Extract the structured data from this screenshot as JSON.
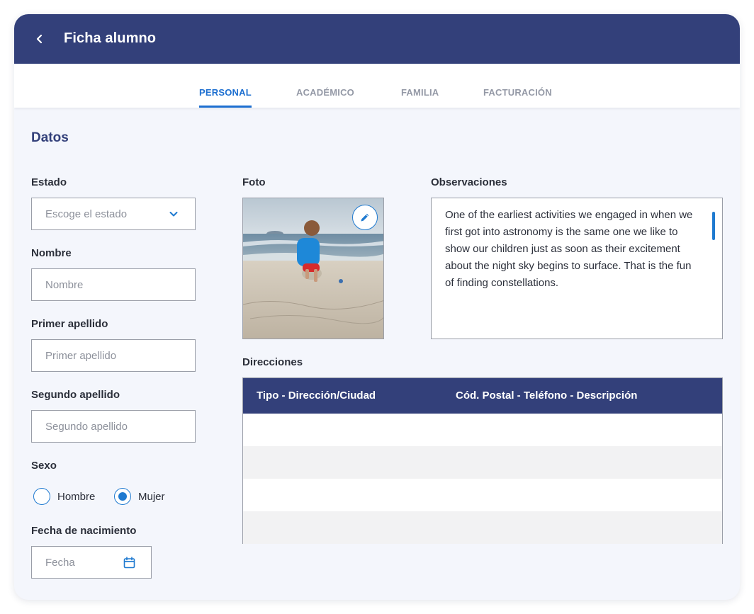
{
  "header": {
    "title": "Ficha alumno",
    "back_icon": "chevron-left-icon"
  },
  "tabs": [
    {
      "label": "PERSONAL",
      "active": true
    },
    {
      "label": "ACADÉMICO",
      "active": false
    },
    {
      "label": "FAMILIA",
      "active": false
    },
    {
      "label": "FACTURACIÓN",
      "active": false
    }
  ],
  "section": {
    "title": "Datos"
  },
  "form": {
    "estado": {
      "label": "Estado",
      "placeholder": "Escoge el estado",
      "icon": "chevron-down-icon"
    },
    "nombre": {
      "label": "Nombre",
      "placeholder": "Nombre"
    },
    "primer_apellido": {
      "label": "Primer apellido",
      "placeholder": "Primer apellido"
    },
    "segundo_apellido": {
      "label": "Segundo apellido",
      "placeholder": "Segundo apellido"
    },
    "sexo": {
      "label": "Sexo",
      "options": [
        {
          "label": "Hombre",
          "selected": false
        },
        {
          "label": "Mujer",
          "selected": true
        }
      ]
    },
    "fecha": {
      "label": "Fecha de nacimiento",
      "placeholder": "Fecha",
      "icon": "calendar-icon"
    }
  },
  "foto": {
    "label": "Foto",
    "edit_icon": "pencil-icon"
  },
  "observaciones": {
    "label": "Observaciones",
    "text": "One of the earliest activities we engaged in when we first got into astronomy is the same one we like to show our children just as soon as their excitement about the night sky begins to surface. That is the fun of finding constellations."
  },
  "direcciones": {
    "label": "Direcciones",
    "columns": [
      "Tipo - Dirección/Ciudad",
      "Cód. Postal - Teléfono - Descripción"
    ],
    "rows": [
      [],
      [],
      [],
      []
    ]
  },
  "colors": {
    "primary": "#33407a",
    "accent": "#1d6fd0",
    "background": "#f4f6fc"
  }
}
